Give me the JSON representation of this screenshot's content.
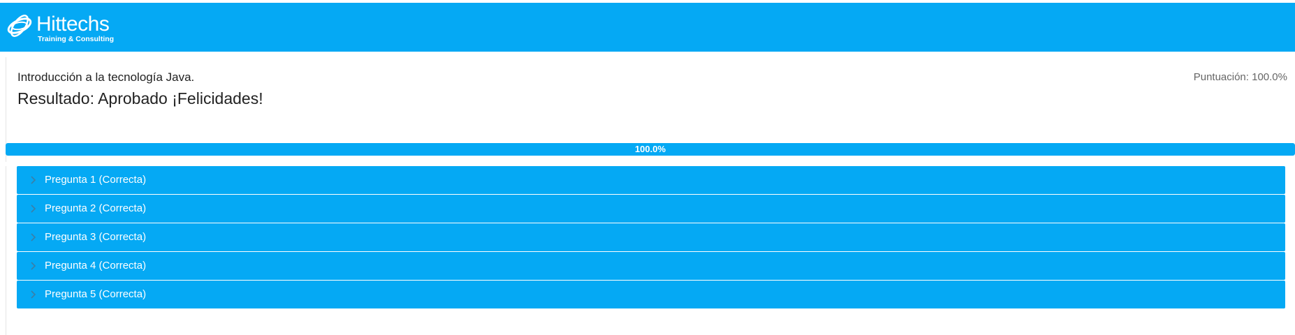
{
  "header": {
    "brand_name": "Hittechs",
    "brand_tagline": "Training & Consulting",
    "logo_icon": "swirl-globe-icon",
    "bar_color": "#05a9f4"
  },
  "result": {
    "course_title": "Introducción a la tecnología Java.",
    "result_text": "Resultado: Aprobado ¡Felicidades!",
    "score_text": "Puntuación: 100.0%"
  },
  "progress": {
    "value_percent": 100,
    "label": "100.0%",
    "color": "#05a9f4"
  },
  "questions": [
    {
      "label": "Pregunta 1 (Correcta)",
      "icon": "chevron-right-icon"
    },
    {
      "label": "Pregunta 2 (Correcta)",
      "icon": "chevron-right-icon"
    },
    {
      "label": "Pregunta 3 (Correcta)",
      "icon": "chevron-right-icon"
    },
    {
      "label": "Pregunta 4 (Correcta)",
      "icon": "chevron-right-icon"
    },
    {
      "label": "Pregunta 5 (Correcta)",
      "icon": "chevron-right-icon"
    }
  ]
}
